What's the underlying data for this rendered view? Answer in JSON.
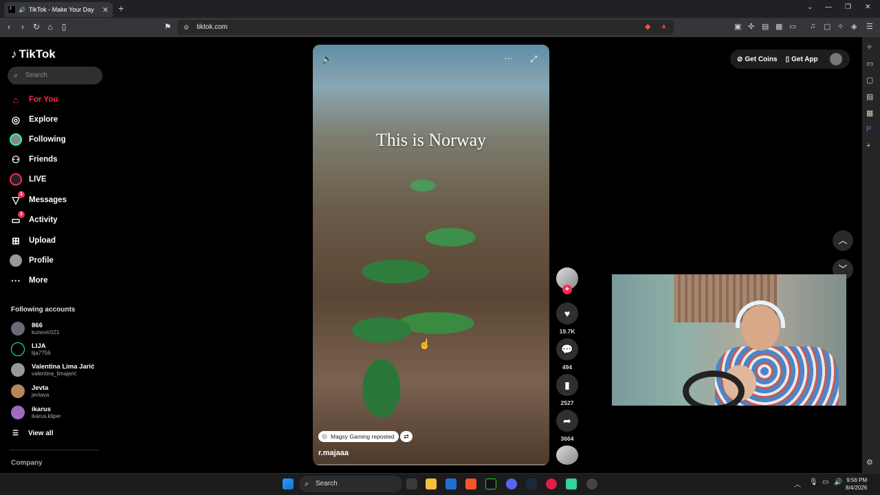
{
  "browser": {
    "tab_title": "TikTok - Make Your Day",
    "url": "tiktok.com",
    "new_tab": "+",
    "tab_close": "✕"
  },
  "sidebar": {
    "logo": "TikTok",
    "search_placeholder": "Search",
    "nav": [
      {
        "label": "For You",
        "icon": "home-icon",
        "active": true
      },
      {
        "label": "Explore",
        "icon": "compass-icon"
      },
      {
        "label": "Following",
        "icon": "following-avatar-icon"
      },
      {
        "label": "Friends",
        "icon": "friends-icon"
      },
      {
        "label": "LIVE",
        "icon": "live-icon"
      },
      {
        "label": "Messages",
        "icon": "messages-icon",
        "badge": "1"
      },
      {
        "label": "Activity",
        "icon": "activity-icon",
        "badge": "1"
      },
      {
        "label": "Upload",
        "icon": "upload-icon"
      },
      {
        "label": "Profile",
        "icon": "profile-icon"
      },
      {
        "label": "More",
        "icon": "more-icon"
      }
    ],
    "following_title": "Following accounts",
    "accounts": [
      {
        "name": "866",
        "handle": "kunovic021"
      },
      {
        "name": "LIJA",
        "handle": "lija7756"
      },
      {
        "name": "Valentina Lima Jarić",
        "handle": "valentina_limajaric"
      },
      {
        "name": "Jevta",
        "handle": "jevtava"
      },
      {
        "name": "ikarus",
        "handle": "ikarus.kliper"
      }
    ],
    "view_all": "View all",
    "company": "Company"
  },
  "video": {
    "overlay_text": "This is Norway",
    "repost_label": "Magsy Gaming reposted",
    "author": "r.majaaa"
  },
  "actions": {
    "likes": "19.7K",
    "comments": "494",
    "saves": "2527",
    "shares": "3664"
  },
  "topright": {
    "get_coins": "Get Coins",
    "get_app": "Get App"
  },
  "taskbar": {
    "search": "Search",
    "time": "9:56 PM",
    "date": "8/4/2026"
  },
  "colors": {
    "accent": "#fe2c55",
    "background": "#000000"
  }
}
